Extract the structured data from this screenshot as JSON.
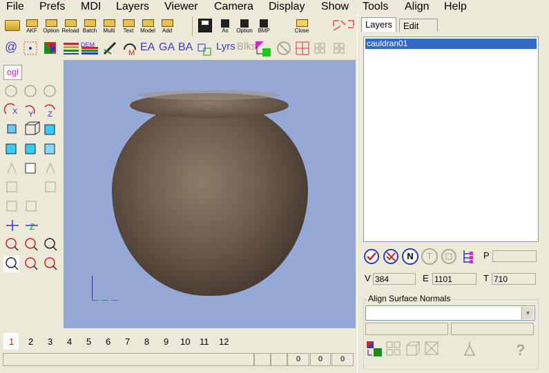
{
  "menu": [
    "File",
    "Prefs",
    "MDI",
    "Layers",
    "Viewer",
    "Camera",
    "Display",
    "Show",
    "Tools",
    "Align",
    "Help"
  ],
  "toolbar1": [
    {
      "name": "open",
      "label": ""
    },
    {
      "name": "akf",
      "label": "AKF"
    },
    {
      "name": "option",
      "label": "Option"
    },
    {
      "name": "reload",
      "label": "Reload"
    },
    {
      "name": "batch",
      "label": "Batch"
    },
    {
      "name": "multi",
      "label": "Multi"
    },
    {
      "name": "text",
      "label": "Text"
    },
    {
      "name": "model",
      "label": "Model"
    },
    {
      "name": "add",
      "label": "Add"
    },
    {
      "name": "save",
      "label": ""
    },
    {
      "name": "save-as",
      "label": "As"
    },
    {
      "name": "save-option",
      "label": "Option"
    },
    {
      "name": "bmp",
      "label": "BMP"
    },
    {
      "name": "close",
      "label": "Close"
    }
  ],
  "toolbar2_text": {
    "dem": "DEM",
    "ea": "EA",
    "ga": "GA",
    "ba": "BA",
    "lyrs": "Lyrs",
    "blks": "Blks"
  },
  "left_tools": {
    "ogl": "ogl"
  },
  "page_numbers": [
    "1",
    "2",
    "3",
    "4",
    "5",
    "6",
    "7",
    "8",
    "9",
    "10",
    "11",
    "12"
  ],
  "active_page": "1",
  "status": [
    "0",
    "0",
    "0"
  ],
  "tabs": {
    "layers": "Layers",
    "edit": "Edit"
  },
  "layers": [
    "cauldran01"
  ],
  "action_buttons": {
    "n": "N",
    "t": "T"
  },
  "p_label": "P",
  "p_value": "",
  "stats": {
    "v_label": "V",
    "v": "384",
    "e_label": "E",
    "e": "1101",
    "t_label": "T",
    "t": "710"
  },
  "align_group": {
    "title": "Align Surface Normals",
    "select_value": ""
  },
  "help_glyph": "?",
  "colors": {
    "accent": "#316ac5",
    "viewport": "#94a9d6",
    "panel": "#ece9d8"
  }
}
